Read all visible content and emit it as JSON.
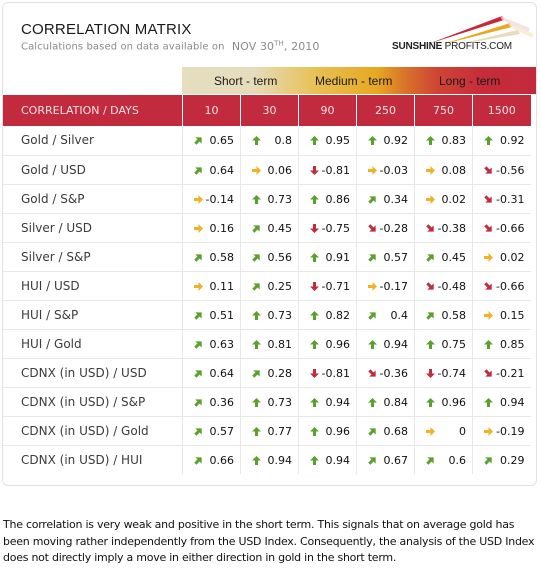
{
  "header": {
    "title": "CORRELATION MATRIX",
    "subtitle": "Calculations based on data available on",
    "date_prefix": "NOV 30",
    "date_sup": "TH",
    "date_suffix": ", 2010",
    "logo_bold": "SUNSHINE",
    "logo_rest": " PROFITS.COM"
  },
  "term_band": {
    "short": "Short - term",
    "medium": "Medium - term",
    "long": "Long - term"
  },
  "colors": {
    "header_red": "#c22a3d",
    "up_green": "#5aa02c",
    "neutral_yellow": "#f0b229",
    "down_red": "#c22a3d"
  },
  "table": {
    "corner_label": "CORRELATION / DAYS",
    "columns": [
      "10",
      "30",
      "90",
      "250",
      "750",
      "1500"
    ],
    "rows": [
      {
        "label": "Gold / Silver",
        "cells": [
          {
            "v": "0.65",
            "icon": "up-right"
          },
          {
            "v": "0.8",
            "icon": "up"
          },
          {
            "v": "0.95",
            "icon": "up"
          },
          {
            "v": "0.92",
            "icon": "up"
          },
          {
            "v": "0.83",
            "icon": "up"
          },
          {
            "v": "0.92",
            "icon": "up"
          }
        ]
      },
      {
        "label": "Gold / USD",
        "cells": [
          {
            "v": "0.64",
            "icon": "up-right"
          },
          {
            "v": "0.06",
            "icon": "right"
          },
          {
            "v": "-0.81",
            "icon": "down"
          },
          {
            "v": "-0.03",
            "icon": "right"
          },
          {
            "v": "0.08",
            "icon": "right"
          },
          {
            "v": "-0.56",
            "icon": "down-right"
          }
        ]
      },
      {
        "label": "Gold / S&P",
        "cells": [
          {
            "v": "-0.14",
            "icon": "right"
          },
          {
            "v": "0.73",
            "icon": "up"
          },
          {
            "v": "0.86",
            "icon": "up"
          },
          {
            "v": "0.34",
            "icon": "up-right"
          },
          {
            "v": "0.02",
            "icon": "right"
          },
          {
            "v": "-0.31",
            "icon": "down-right"
          }
        ]
      },
      {
        "label": "Silver / USD",
        "cells": [
          {
            "v": "0.16",
            "icon": "right"
          },
          {
            "v": "0.45",
            "icon": "up-right"
          },
          {
            "v": "-0.75",
            "icon": "down"
          },
          {
            "v": "-0.28",
            "icon": "down-right"
          },
          {
            "v": "-0.38",
            "icon": "down-right"
          },
          {
            "v": "-0.66",
            "icon": "down-right"
          }
        ]
      },
      {
        "label": "Silver / S&P",
        "cells": [
          {
            "v": "0.58",
            "icon": "up-right"
          },
          {
            "v": "0.56",
            "icon": "up-right"
          },
          {
            "v": "0.91",
            "icon": "up"
          },
          {
            "v": "0.57",
            "icon": "up-right"
          },
          {
            "v": "0.45",
            "icon": "up-right"
          },
          {
            "v": "0.02",
            "icon": "right"
          }
        ]
      },
      {
        "label": "HUI / USD",
        "cells": [
          {
            "v": "0.11",
            "icon": "right"
          },
          {
            "v": "0.25",
            "icon": "up-right"
          },
          {
            "v": "-0.71",
            "icon": "down"
          },
          {
            "v": "-0.17",
            "icon": "right"
          },
          {
            "v": "-0.48",
            "icon": "down-right"
          },
          {
            "v": "-0.66",
            "icon": "down-right"
          }
        ]
      },
      {
        "label": "HUI / S&P",
        "cells": [
          {
            "v": "0.51",
            "icon": "up-right"
          },
          {
            "v": "0.73",
            "icon": "up"
          },
          {
            "v": "0.82",
            "icon": "up"
          },
          {
            "v": "0.4",
            "icon": "up-right"
          },
          {
            "v": "0.58",
            "icon": "up-right"
          },
          {
            "v": "0.15",
            "icon": "right"
          }
        ]
      },
      {
        "label": "HUI / Gold",
        "cells": [
          {
            "v": "0.63",
            "icon": "up-right"
          },
          {
            "v": "0.81",
            "icon": "up"
          },
          {
            "v": "0.96",
            "icon": "up"
          },
          {
            "v": "0.94",
            "icon": "up"
          },
          {
            "v": "0.75",
            "icon": "up"
          },
          {
            "v": "0.85",
            "icon": "up"
          }
        ]
      },
      {
        "label": "CDNX (in USD) / USD",
        "cells": [
          {
            "v": "0.64",
            "icon": "up-right"
          },
          {
            "v": "0.28",
            "icon": "up-right"
          },
          {
            "v": "-0.81",
            "icon": "down"
          },
          {
            "v": "-0.36",
            "icon": "down-right"
          },
          {
            "v": "-0.74",
            "icon": "down"
          },
          {
            "v": "-0.21",
            "icon": "down-right"
          }
        ]
      },
      {
        "label": "CDNX (in USD) / S&P",
        "cells": [
          {
            "v": "0.36",
            "icon": "up-right"
          },
          {
            "v": "0.73",
            "icon": "up"
          },
          {
            "v": "0.94",
            "icon": "up"
          },
          {
            "v": "0.84",
            "icon": "up"
          },
          {
            "v": "0.96",
            "icon": "up"
          },
          {
            "v": "0.94",
            "icon": "up"
          }
        ]
      },
      {
        "label": "CDNX (in USD) / Gold",
        "cells": [
          {
            "v": "0.57",
            "icon": "up-right"
          },
          {
            "v": "0.77",
            "icon": "up"
          },
          {
            "v": "0.96",
            "icon": "up"
          },
          {
            "v": "0.68",
            "icon": "up-right"
          },
          {
            "v": "0",
            "icon": "right"
          },
          {
            "v": "-0.19",
            "icon": "right"
          }
        ]
      },
      {
        "label": "CDNX (in USD) / HUI",
        "cells": [
          {
            "v": "0.66",
            "icon": "up-right"
          },
          {
            "v": "0.94",
            "icon": "up"
          },
          {
            "v": "0.94",
            "icon": "up"
          },
          {
            "v": "0.67",
            "icon": "up-right"
          },
          {
            "v": "0.6",
            "icon": "up-right"
          },
          {
            "v": "0.29",
            "icon": "up-right"
          }
        ]
      }
    ]
  },
  "footer": {
    "text": "The correlation is very weak and positive in the short term. This signals that on average gold has been moving rather independently from the USD Index. Consequently, the analysis of the USD Index does not directly imply a move in either direction in gold in the short term."
  }
}
